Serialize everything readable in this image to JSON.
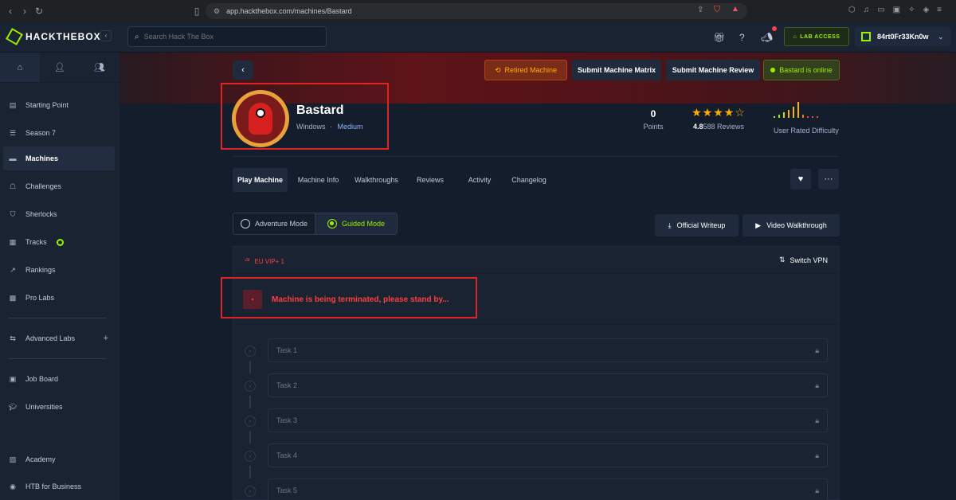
{
  "browser": {
    "url": "app.hackthebox.com/machines/Bastard",
    "nav": [
      "‹",
      "›",
      "↻"
    ]
  },
  "header": {
    "brand": "HACKTHEBOX",
    "search_placeholder": "Search Hack The Box",
    "lab_access": "LAB ACCESS",
    "username": "84rt0Fr33Kn0w"
  },
  "sidebar": {
    "items": [
      {
        "label": "Starting Point",
        "icon": "book-icon"
      },
      {
        "label": "Season 7",
        "icon": "season-icon"
      },
      {
        "label": "Machines",
        "icon": "machines-icon"
      },
      {
        "label": "Challenges",
        "icon": "challenges-icon"
      },
      {
        "label": "Sherlocks",
        "icon": "shield-icon"
      },
      {
        "label": "Tracks",
        "icon": "tracks-icon"
      },
      {
        "label": "Rankings",
        "icon": "trend-icon"
      },
      {
        "label": "Pro Labs",
        "icon": "prolabs-icon"
      },
      {
        "label": "Advanced Labs",
        "icon": "advanced-icon"
      },
      {
        "label": "Job Board",
        "icon": "briefcase-icon"
      },
      {
        "label": "Universities",
        "icon": "graduation-icon"
      },
      {
        "label": "Academy",
        "icon": "academy-icon"
      },
      {
        "label": "HTB for Business",
        "icon": "business-icon"
      }
    ],
    "active": "Machines",
    "plus": "+"
  },
  "topbar": {
    "retired": "Retired Machine",
    "matrix": "Submit Machine Matrix",
    "review": "Submit Machine Review",
    "online": "Bastard is online"
  },
  "machine": {
    "name": "Bastard",
    "os": "Windows",
    "separator": "·",
    "difficulty": "Medium",
    "points_value": "0",
    "points_label": "Points",
    "rating": "4.8",
    "reviews": "588 Reviews",
    "stars": "★★★★☆",
    "difficulty_label": "User Rated Difficulty"
  },
  "tabs": [
    "Play Machine",
    "Machine Info",
    "Walkthroughs",
    "Reviews",
    "Activity",
    "Changelog"
  ],
  "modes": {
    "adventure": "Adventure Mode",
    "guided": "Guided Mode",
    "selected": "Guided Mode"
  },
  "walkthroughs": {
    "writeup": "Official Writeup",
    "video": "Video Walkthrough"
  },
  "vpn": {
    "server": "EU VIP+ 1",
    "switch": "Switch VPN"
  },
  "status": {
    "message": "Machine is being terminated, please stand by..."
  },
  "tasks": [
    "Task 1",
    "Task 2",
    "Task 3",
    "Task 4",
    "Task 5"
  ],
  "colors": {
    "accent_green": "#9fef00",
    "danger_red": "#ff3e3e",
    "retired_orange": "#ffaf00",
    "highlight_border": "#e02424"
  }
}
